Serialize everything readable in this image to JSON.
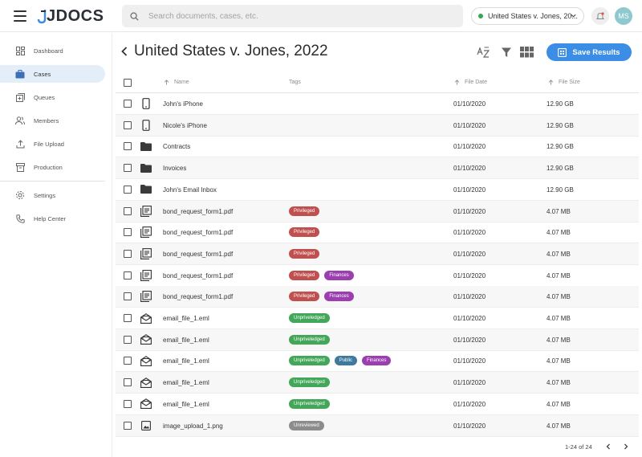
{
  "app": {
    "logo": "JDOCS"
  },
  "search": {
    "placeholder": "Search documents, cases, etc."
  },
  "case_selector": {
    "label": "United States v. Jones, 20...",
    "status_color": "#34a853"
  },
  "user": {
    "initials": "MS"
  },
  "sidebar": {
    "items": [
      {
        "label": "Dashboard",
        "icon": "dashboard-icon",
        "active": false
      },
      {
        "label": "Cases",
        "icon": "briefcase-icon",
        "active": true
      },
      {
        "label": "Queues",
        "icon": "queue-icon",
        "active": false
      },
      {
        "label": "Members",
        "icon": "members-icon",
        "active": false
      },
      {
        "label": "File Upload",
        "icon": "upload-icon",
        "active": false
      },
      {
        "label": "Production",
        "icon": "archive-icon",
        "active": false
      },
      {
        "label": "Settings",
        "icon": "gear-icon",
        "active": false
      },
      {
        "label": "Help Center",
        "icon": "phone-icon",
        "active": false
      }
    ]
  },
  "header": {
    "title": "United States v. Jones, 2022",
    "save_label": "Save Results",
    "accent": "#3b8de6"
  },
  "table": {
    "columns": {
      "name": "Name",
      "tags": "Tags",
      "date": "File Date",
      "size": "File Size"
    },
    "tag_colors": {
      "Privileged": "#c0504d",
      "Finances": "#9b3fb0",
      "Unpriveledged": "#43a75a",
      "Public": "#3f7a9e",
      "Unreviewed": "#8c8c8c"
    },
    "rows": [
      {
        "icon": "phone-icon",
        "name": "John's iPhone",
        "tags": [],
        "date": "01/10/2020",
        "size": "12.90 GB"
      },
      {
        "icon": "phone-icon",
        "name": "Nicole's iPhone",
        "tags": [],
        "date": "01/10/2020",
        "size": "12.90 GB"
      },
      {
        "icon": "folder-icon",
        "name": "Contracts",
        "tags": [],
        "date": "01/10/2020",
        "size": "12.90 GB"
      },
      {
        "icon": "folder-icon",
        "name": "Invoices",
        "tags": [],
        "date": "01/10/2020",
        "size": "12.90 GB"
      },
      {
        "icon": "folder-icon",
        "name": "John's Email Inbox",
        "tags": [],
        "date": "01/10/2020",
        "size": "12.90 GB"
      },
      {
        "icon": "pdf-icon",
        "name": "bond_request_form1.pdf",
        "tags": [
          "Privileged"
        ],
        "date": "01/10/2020",
        "size": "4.07 MB"
      },
      {
        "icon": "pdf-icon",
        "name": "bond_request_form1.pdf",
        "tags": [
          "Privileged"
        ],
        "date": "01/10/2020",
        "size": "4.07 MB"
      },
      {
        "icon": "pdf-icon",
        "name": "bond_request_form1.pdf",
        "tags": [
          "Privileged"
        ],
        "date": "01/10/2020",
        "size": "4.07 MB"
      },
      {
        "icon": "pdf-icon",
        "name": "bond_request_form1.pdf",
        "tags": [
          "Privileged",
          "Finances"
        ],
        "date": "01/10/2020",
        "size": "4.07 MB"
      },
      {
        "icon": "pdf-icon",
        "name": "bond_request_form1.pdf",
        "tags": [
          "Privileged",
          "Finances"
        ],
        "date": "01/10/2020",
        "size": "4.07 MB"
      },
      {
        "icon": "email-icon",
        "name": "email_file_1.eml",
        "tags": [
          "Unpriveledged"
        ],
        "date": "01/10/2020",
        "size": "4.07 MB"
      },
      {
        "icon": "email-icon",
        "name": "email_file_1.eml",
        "tags": [
          "Unpriveledged"
        ],
        "date": "01/10/2020",
        "size": "4.07 MB"
      },
      {
        "icon": "email-icon",
        "name": "email_file_1.eml",
        "tags": [
          "Unpriveledged",
          "Public",
          "Finances"
        ],
        "date": "01/10/2020",
        "size": "4.07 MB"
      },
      {
        "icon": "email-icon",
        "name": "email_file_1.eml",
        "tags": [
          "Unpriveledged"
        ],
        "date": "01/10/2020",
        "size": "4.07 MB"
      },
      {
        "icon": "email-icon",
        "name": "email_file_1.eml",
        "tags": [
          "Unpriveledged"
        ],
        "date": "01/10/2020",
        "size": "4.07 MB"
      },
      {
        "icon": "image-icon",
        "name": "image_upload_1.png",
        "tags": [
          "Unreviewed"
        ],
        "date": "01/10/2020",
        "size": "4.07 MB"
      }
    ]
  },
  "pagination": {
    "text": "1-24 of 24"
  }
}
